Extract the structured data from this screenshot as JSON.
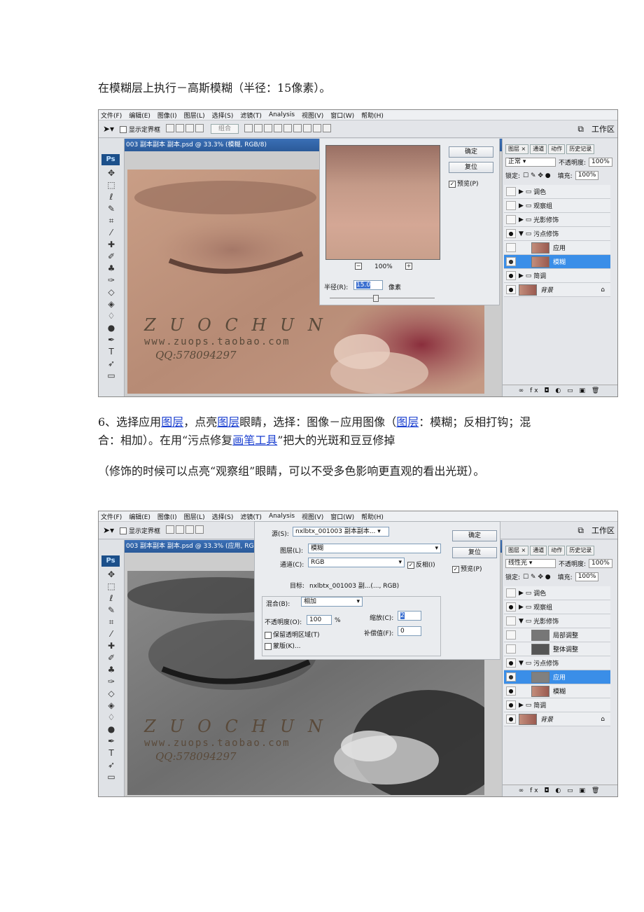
{
  "paragraphs": {
    "p1": "在模糊层上执行－高斯模糊（半径：15像素）。",
    "p2_a": "6、选择应用",
    "p2_link1": "图层",
    "p2_b": "，点亮",
    "p2_link2": "图层",
    "p2_c": "眼睛，选择：图像－应用图像（",
    "p2_link3": "图层",
    "p2_d": "：模糊；反相打钩；混合：相加）。在用“污点修复",
    "p2_link4": "画笔工具",
    "p2_e": "”把大的光斑和豆豆修掉",
    "p3": "（修饰的时候可以点亮“观察组”眼睛，可以不受多色影响更直观的看出光斑）。"
  },
  "menu": [
    "文件(F)",
    "编辑(E)",
    "图像(I)",
    "图层(L)",
    "选择(S)",
    "滤镜(T)",
    "Analysis",
    "视图(V)",
    "窗口(W)",
    "帮助(H)"
  ],
  "options": {
    "show_bounds": "显示定界框",
    "combine": "组合",
    "workspace": "工作区"
  },
  "ps_label": "Ps",
  "shot1": {
    "doc_title": "003 副本副本 副本.psd @ 33.3% (模糊, RGB/8)",
    "dialog": {
      "ok": "确定",
      "reset": "复位",
      "preview": "预览(P)",
      "zoom": "100%",
      "radius_label": "半径(R):",
      "radius_value": "15.0",
      "unit": "像素"
    },
    "panel": {
      "tabs": [
        "图层 ×",
        "通道",
        "动作",
        "历史记录"
      ],
      "blend": "正常",
      "opacity_label": "不透明度:",
      "opacity": "100%",
      "lock_label": "锁定:",
      "fill_label": "填充:",
      "fill": "100%",
      "layers": [
        "调色",
        "观察组",
        "光影修饰",
        "污点修饰",
        "应用",
        "模糊",
        "简调",
        "背景"
      ]
    }
  },
  "shot2": {
    "doc_title": "003 副本副本 副本.psd @ 33.3% (应用, RGB/8)",
    "dialog": {
      "source_label": "源(S):",
      "source": "nxlbtx_001003 副本副本...",
      "layer_label": "图层(L):",
      "layer": "模糊",
      "channel_label": "通道(C):",
      "channel": "RGB",
      "invert": "反相(I)",
      "target_label": "目标:",
      "target": "nxlbtx_001003 副...(..., RGB)",
      "blend_label": "混合(B):",
      "blend": "相加",
      "opacity_label": "不透明度(O):",
      "opacity": "100",
      "percent": "%",
      "scale_label": "缩放(C):",
      "scale": "2",
      "offset_label": "补偿值(F):",
      "offset": "0",
      "preserve": "保留透明区域(T)",
      "mask": "蒙版(K)...",
      "ok": "确定",
      "reset": "复位",
      "preview": "预览(P)"
    },
    "panel": {
      "tabs": [
        "图层 ×",
        "通道",
        "动作",
        "历史记录"
      ],
      "blend": "线性光",
      "opacity_label": "不透明度:",
      "opacity": "100%",
      "lock_label": "锁定:",
      "fill_label": "填充:",
      "fill": "100%",
      "layers": [
        "调色",
        "观察组",
        "光影修饰",
        "局部调整",
        "整体调整",
        "污点修饰",
        "应用",
        "模糊",
        "简调",
        "背景"
      ]
    }
  },
  "watermark": {
    "name": "Z U O C H U N",
    "url": "www.zuops.taobao.com",
    "qq": "QQ:578094297"
  }
}
